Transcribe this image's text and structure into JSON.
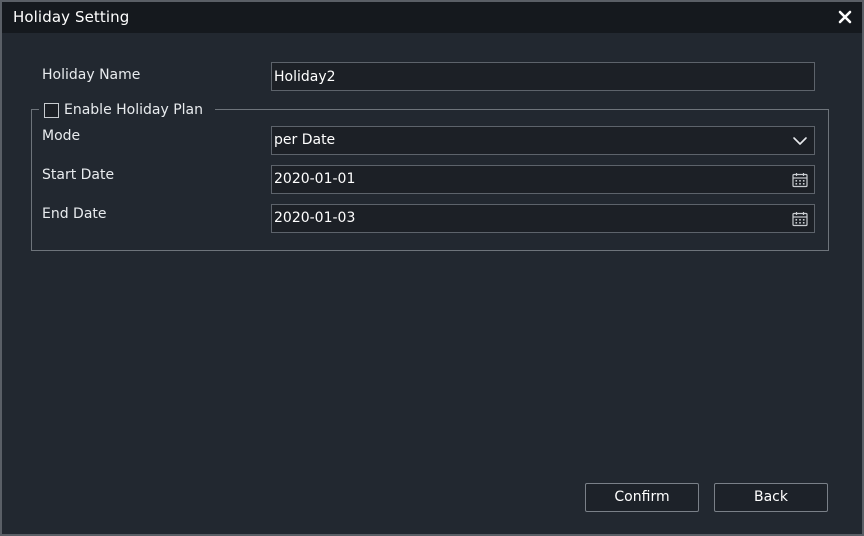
{
  "dialog": {
    "title": "Holiday Setting",
    "close_icon": "close-icon"
  },
  "form": {
    "holiday_name_label": "Holiday Name",
    "holiday_name_value": "Holiday2",
    "enable_plan_label": "Enable Holiday Plan",
    "enable_plan_checked": false,
    "mode_label": "Mode",
    "mode_value": "per Date",
    "start_date_label": "Start Date",
    "start_date_value": "2020-01-01",
    "end_date_label": "End Date",
    "end_date_value": "2020-01-03",
    "calendar_icon": "calendar-icon",
    "dropdown_icon": "chevron-down-icon"
  },
  "buttons": {
    "confirm": "Confirm",
    "back": "Back"
  },
  "colors": {
    "background": "#222830",
    "titlebar": "#15191e",
    "field_bg": "#1c2026",
    "border": "#5d636b"
  }
}
